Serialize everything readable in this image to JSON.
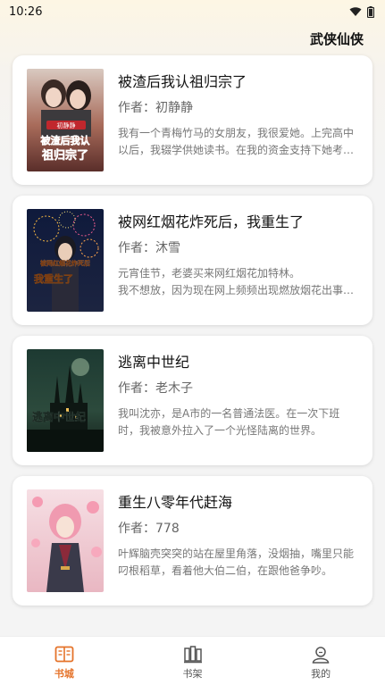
{
  "status_bar": {
    "time": "10:26"
  },
  "header": {
    "category": "武侠仙侠"
  },
  "books": [
    {
      "title": "被渣后我认祖归宗了",
      "author": "作者：初静静",
      "description": "我有一个青梅竹马的女朋友，我很爱她。上完高中以后，我辍学供她读书。在我的资金支持下她考上了大学。",
      "cover_text": [
        "初静静",
        "被渣后我认",
        "祖归宗了"
      ]
    },
    {
      "title": "被网红烟花炸死后，我重生了",
      "author": "作者：沐雪",
      "description": "元宵佳节，老婆买来网红烟花加特林。\n       我不想放，因为现在网上频频出现燃放烟花出事的新闻。",
      "cover_text": [
        "被网红烟花炸死后",
        "我重生了"
      ]
    },
    {
      "title": "逃离中世纪",
      "author": "作者：老木子",
      "description": "我叫沈亦，是A市的一名普通法医。在一次下班时，我被意外拉入了一个光怪陆离的世界。",
      "cover_text": [
        "逃离中世纪"
      ]
    },
    {
      "title": "重生八零年代赶海",
      "author": "作者：778",
      "description": "叶辉脑壳突突的站在屋里角落，没烟抽，嘴里只能叼根稻草，看着他大伯二伯，在跟他爸争吵。",
      "cover_text": []
    }
  ],
  "tabs": [
    {
      "label": "书城",
      "icon": "book-open-icon",
      "active": true
    },
    {
      "label": "书架",
      "icon": "bookshelf-icon",
      "active": false
    },
    {
      "label": "我的",
      "icon": "user-icon",
      "active": false
    }
  ],
  "colors": {
    "accent": "#e5732a"
  }
}
